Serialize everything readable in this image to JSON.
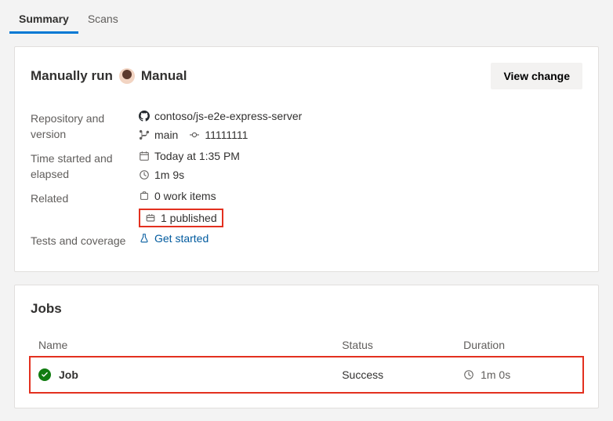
{
  "tabs": [
    {
      "label": "Summary",
      "active": true
    },
    {
      "label": "Scans",
      "active": false
    }
  ],
  "summary": {
    "titlePrefix": "Manually run",
    "titleSuffix": "Manual",
    "viewChangeLabel": "View change",
    "details": {
      "repoVersionLabel": "Repository and version",
      "repo": "contoso/js-e2e-express-server",
      "branch": "main",
      "commit": "11111111",
      "timeLabel": "Time started and elapsed",
      "startedAt": "Today at 1:35 PM",
      "elapsed": "1m 9s",
      "relatedLabel": "Related",
      "workItems": "0 work items",
      "published": "1 published",
      "testsLabel": "Tests and coverage",
      "testsLink": "Get started"
    }
  },
  "jobs": {
    "title": "Jobs",
    "columns": {
      "name": "Name",
      "status": "Status",
      "duration": "Duration"
    },
    "rows": [
      {
        "name": "Job",
        "status": "Success",
        "duration": "1m 0s"
      }
    ]
  }
}
